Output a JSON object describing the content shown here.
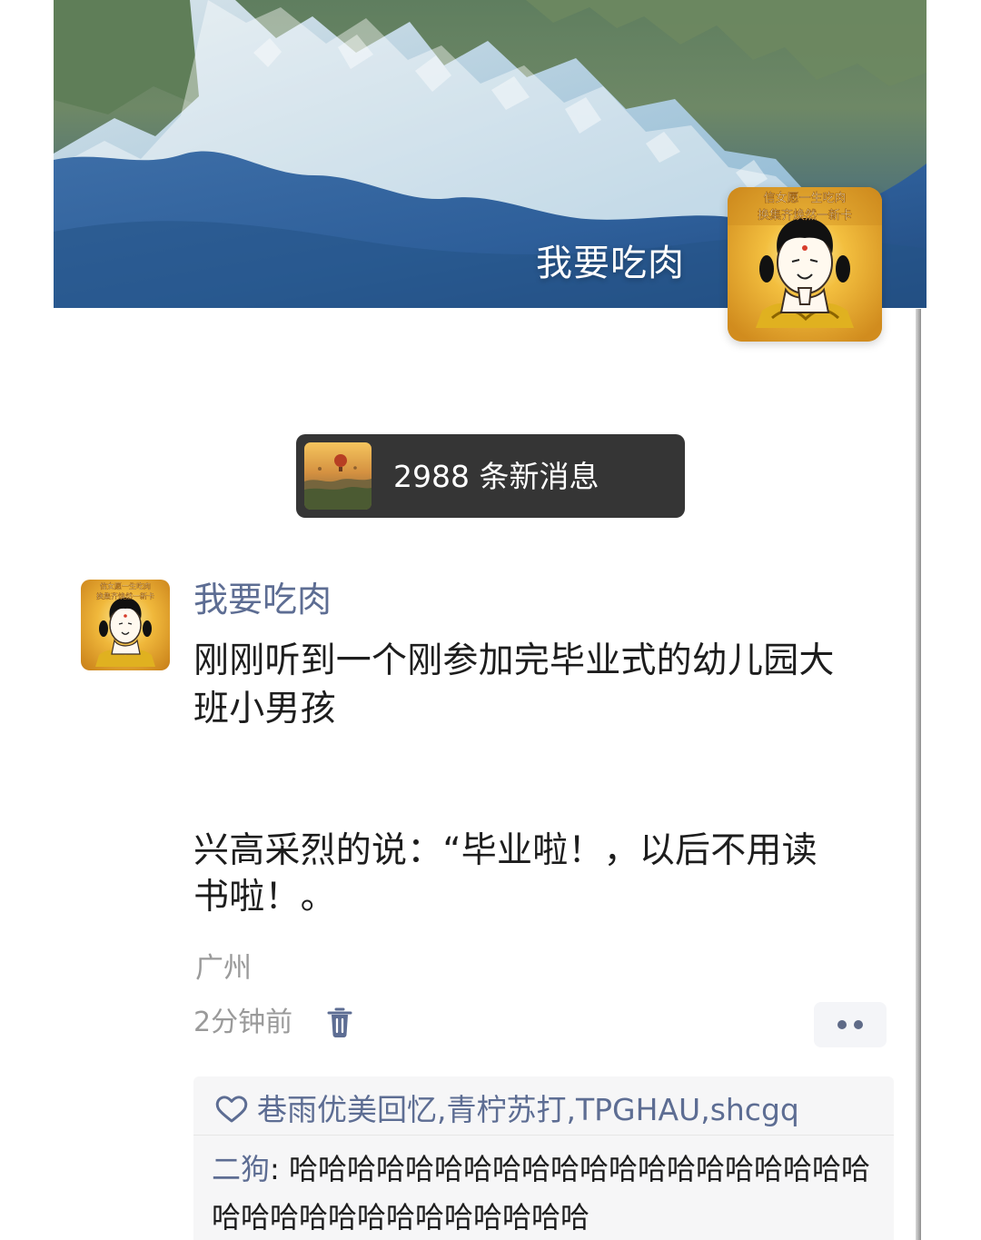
{
  "cover": {
    "display_name": "我要吃肉"
  },
  "profile": {
    "avatar_caption": "信女愿一生吃肉 换集齐焕然一新卡"
  },
  "notice": {
    "text": "2988 条新消息"
  },
  "post": {
    "author": "我要吃肉",
    "lines": [
      "刚刚听到一个刚参加完毕业式的幼儿园大",
      "班小男孩",
      "兴高采烈的说：“毕业啦！，以后不用读",
      "书啦！。"
    ],
    "location": "广州",
    "time": "2分钟前"
  },
  "interactions": {
    "likes": [
      "巷雨优美回忆",
      "青柠苏打",
      "TPGHAU",
      "shcgq"
    ],
    "comment": {
      "author": "二狗",
      "text": "哈哈哈哈哈哈哈哈哈哈哈哈哈哈哈哈哈哈哈哈哈哈哈哈哈哈哈哈哈哈哈哈哈"
    }
  },
  "colors": {
    "name_blue": "#5d6d93",
    "notice_bg": "#353535",
    "panel_bg": "#f6f6f7"
  },
  "icons": {
    "trash": "trash-icon",
    "more": "more-options-icon",
    "heart": "heart-icon"
  }
}
